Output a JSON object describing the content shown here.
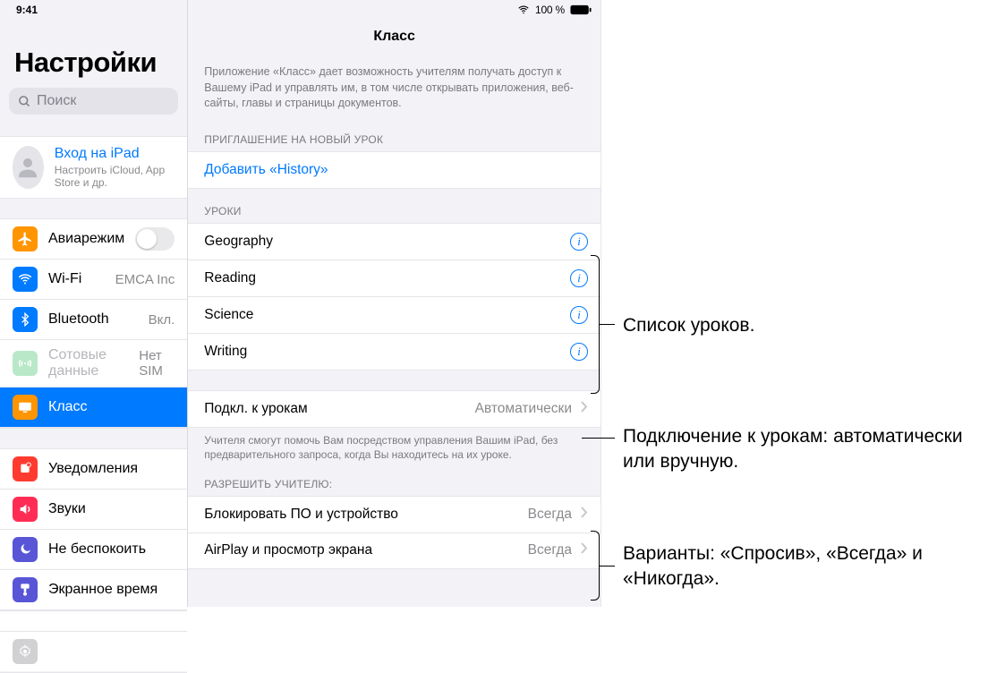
{
  "status": {
    "time": "9:41",
    "battery_pct": "100 %"
  },
  "sidebar": {
    "title": "Настройки",
    "search_placeholder": "Поиск",
    "signin": {
      "line1": "Вход на iPad",
      "line2": "Настроить iCloud, App Store и др."
    },
    "g1": {
      "airplane": "Авиарежим",
      "wifi": "Wi-Fi",
      "wifi_val": "EMCA Inc",
      "bt": "Bluetooth",
      "bt_val": "Вкл.",
      "cell": "Сотовые данные",
      "cell_val": "Нет SIM",
      "class": "Класс"
    },
    "g2": {
      "notif": "Уведомления",
      "sounds": "Звуки",
      "dnd": "Не беспокоить",
      "screentime": "Экранное время"
    }
  },
  "detail": {
    "title": "Класс",
    "desc": "Приложение «Класс» дает возможность учителям получать доступ к Вашему iPad и управлять им, в том числе открывать приложения, веб-сайты, главы и страницы документов.",
    "invite_header": "ПРИГЛАШЕНИЕ НА НОВЫЙ УРОК",
    "invite_action": "Добавить «History»",
    "classes_header": "УРОКИ",
    "classes": [
      "Geography",
      "Reading",
      "Science",
      "Writing"
    ],
    "join_label": "Подкл. к урокам",
    "join_value": "Автоматически",
    "join_footer": "Учителя смогут помочь Вам посредством управления Вашим iPad, без предварительного запроса, когда Вы находитесь на их уроке.",
    "allow_header": "РАЗРЕШИТЬ УЧИТЕЛЮ:",
    "allow": [
      {
        "label": "Блокировать ПО и устройство",
        "value": "Всегда"
      },
      {
        "label": "AirPlay и просмотр экрана",
        "value": "Всегда"
      }
    ]
  },
  "callouts": {
    "c1": "Список уроков.",
    "c2": "Подключение к урокам: автоматически или вручную.",
    "c3": "Варианты: «Спросив», «Всегда» и «Никогда»."
  }
}
